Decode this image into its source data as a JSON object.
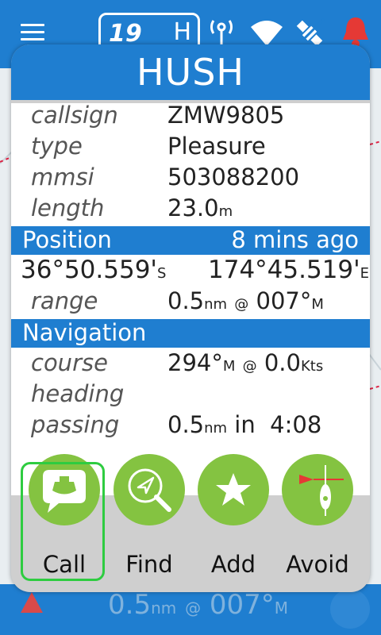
{
  "topbar": {
    "speed_value": "19",
    "speed_unit": "H",
    "icons": [
      "menu-icon",
      "radio-tower-icon",
      "wifi-icon",
      "satellite-icon",
      "alarm-bell-icon"
    ]
  },
  "dialog": {
    "title": "HUSH",
    "details": {
      "callsign_label": "callsign",
      "callsign_value": "ZMW9805",
      "type_label": "type",
      "type_value": "Pleasure",
      "mmsi_label": "mmsi",
      "mmsi_value": "503088200",
      "length_label": "length",
      "length_value": "23.0",
      "length_unit": "m"
    },
    "position": {
      "header": "Position",
      "age": "8 mins ago",
      "lat_value": "36°50.559'",
      "lat_hemi": "S",
      "lon_value": "174°45.519'",
      "lon_hemi": "E",
      "range_label": "range",
      "range_value": "0.5",
      "range_unit": "nm",
      "range_at": "@",
      "range_bearing": "007°",
      "range_bearing_ref": "M"
    },
    "navigation": {
      "header": "Navigation",
      "course_label": "course",
      "course_value": "294°",
      "course_ref": "M",
      "course_at": "@",
      "speed_value": "0.0",
      "speed_unit": "Kts",
      "heading_label": "heading",
      "heading_value": "",
      "passing_label": "passing",
      "passing_value": "0.5",
      "passing_unit": "nm",
      "passing_in": "in",
      "passing_time": "4:08"
    },
    "actions": [
      {
        "label": "Call",
        "icon": "boat-call-icon",
        "selected": true
      },
      {
        "label": "Find",
        "icon": "find-magnifier-icon"
      },
      {
        "label": "Add",
        "icon": "star-icon"
      },
      {
        "label": "Avoid",
        "icon": "avoid-buoy-icon"
      }
    ]
  },
  "bottombar": {
    "range_value": "0.5",
    "range_unit": "nm",
    "at": "@",
    "bearing": "007°",
    "bearing_ref": "M"
  },
  "colors": {
    "primary": "#1f7ed0",
    "action_green": "#84c341",
    "selected_outline": "#2ecc40",
    "panel_gray": "#cfcfcf"
  }
}
